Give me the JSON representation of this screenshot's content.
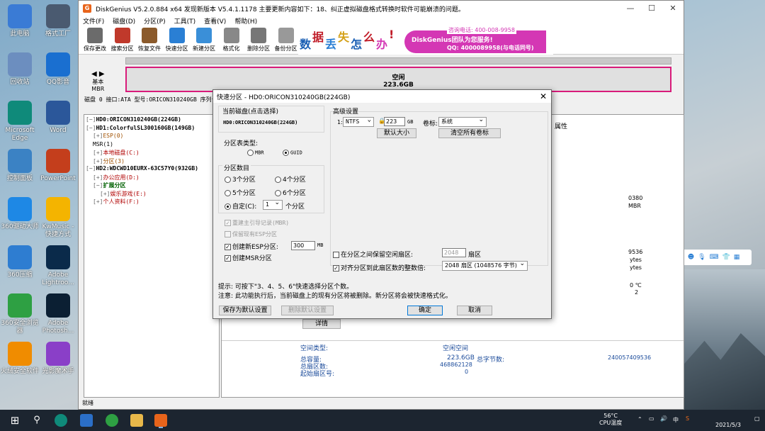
{
  "desktop": {
    "icons": [
      {
        "label": "此电脑",
        "color": "#3a7bd5"
      },
      {
        "label": "格式工厂",
        "color": "#4a5a70"
      },
      {
        "label": "回收站",
        "color": "#6c8ebf"
      },
      {
        "label": "QQ影音",
        "color": "#1a6fd0"
      },
      {
        "label": "Microsoft Edge",
        "color": "#0f8a7a"
      },
      {
        "label": "Word",
        "color": "#2b579a"
      },
      {
        "label": "控制面板",
        "color": "#3b82c4"
      },
      {
        "label": "PowerPoint",
        "color": "#c43e1c"
      },
      {
        "label": "360驱动大师",
        "color": "#1e88e5"
      },
      {
        "label": "KwMusic - 快捷方式",
        "color": "#f4b400"
      },
      {
        "label": "360压缩",
        "color": "#2e7dd1"
      },
      {
        "label": "Adobe Lightroo...",
        "color": "#0a2a4a"
      },
      {
        "label": "360安全浏览器",
        "color": "#2ea043"
      },
      {
        "label": "Adobe Photosh...",
        "color": "#0b1f33"
      },
      {
        "label": "火绒安全软件",
        "color": "#f08c00"
      },
      {
        "label": "光影魔术手",
        "color": "#8a3fc8"
      }
    ]
  },
  "app": {
    "title": "DiskGenius V5.2.0.884 x64   发现新版本 V5.4.1.1178 主要更新内容如下：18、纠正虚拟磁盘格式转换时软件可能崩溃的问题。",
    "menu": [
      "文件(F)",
      "磁盘(D)",
      "分区(P)",
      "工具(T)",
      "查看(V)",
      "帮助(H)"
    ],
    "toolbar": [
      {
        "label": "保存更改",
        "color": "#6b6b6b"
      },
      {
        "label": "搜索分区",
        "color": "#c0392b"
      },
      {
        "label": "恢复文件",
        "color": "#8b5a2b"
      },
      {
        "label": "快速分区",
        "color": "#2a7fd4"
      },
      {
        "label": "新建分区",
        "color": "#3a8fd8"
      },
      {
        "label": "格式化",
        "color": "#888888"
      },
      {
        "label": "删除分区",
        "color": "#777777"
      },
      {
        "label": "备份分区",
        "color": "#999999"
      }
    ],
    "banner": {
      "chars": [
        "数",
        "据",
        "丢",
        "失",
        "怎",
        "么",
        "办",
        "!"
      ],
      "phone": "咨询电话: 400-008-9958",
      "team": "DiskGenius团队为您服务!",
      "qq": "QQ: 4000089958(与电话同号)"
    },
    "diskmap": {
      "basic": "基本",
      "mbr": "MBR",
      "free_label": "空闲",
      "free_size": "223.6GB"
    },
    "disk_info": "磁盘 0 接口:ATA  型号:ORICON310240GB  序列号",
    "tree": [
      {
        "text": "HD0:ORICON310240GB(224GB)",
        "cls": "bold",
        "indent": 0,
        "exp": "−"
      },
      {
        "text": "HD1:ColorfulSL300160GB(149GB)",
        "cls": "bold",
        "indent": 0,
        "exp": "−"
      },
      {
        "text": "ESP(0)",
        "cls": "org",
        "indent": 2,
        "exp": "+"
      },
      {
        "text": "MSR(1)",
        "cls": "",
        "indent": 2,
        "exp": ""
      },
      {
        "text": "本地磁盘(C:)",
        "cls": "red",
        "indent": 2,
        "exp": "+"
      },
      {
        "text": "分区(3)",
        "cls": "org",
        "indent": 2,
        "exp": "+"
      },
      {
        "text": "HD2:WDCWD10EURX-63C57Y0(932GB)",
        "cls": "bold",
        "indent": 0,
        "exp": "−"
      },
      {
        "text": "办公应用(D:)",
        "cls": "red",
        "indent": 2,
        "exp": "+"
      },
      {
        "text": "扩展分区",
        "cls": "grn",
        "indent": 2,
        "exp": "−"
      },
      {
        "text": "娱乐游戏(E:)",
        "cls": "red",
        "indent": 4,
        "exp": "+"
      },
      {
        "text": "个人资料(F:)",
        "cls": "red",
        "indent": 2,
        "exp": "+"
      }
    ],
    "right_pane": {
      "attr_header": "属性",
      "r1": "0380",
      "r2": "MBR",
      "r3": "9536",
      "r4": "ytes",
      "r5": "ytes",
      "temp": "0 ℃",
      "two": "2",
      "detail_button": "详情",
      "space_type_label": "空间类型:",
      "space_type_value": "空闲空间",
      "total_label": "总容量:",
      "total_value": "223.6GB",
      "total_bytes_label": "总字节数:",
      "total_bytes_value": "240057409536",
      "sectors_label": "总扇区数:",
      "sectors_value": "468862128",
      "start_label": "起始扇区号:",
      "start_value": "0"
    },
    "status": "就绪"
  },
  "dialog": {
    "title": "快速分区 - HD0:ORICON310240GB(224GB)",
    "current_disk_label": "当前磁盘(点击选择)",
    "current_disk_value": "HD0:ORICON310240GB(224GB)",
    "table_type_label": "分区表类型:",
    "mbr": "MBR",
    "guid": "GUID",
    "count_label": "分区数目",
    "opt3": "3个分区",
    "opt4": "4个分区",
    "opt5": "5个分区",
    "opt6": "6个分区",
    "custom": "自定(C):",
    "custom_value": "1",
    "custom_unit": "个分区",
    "rebuild_mbr": "重建主引导记录(MBR)",
    "keep_esp": "保留现有ESP分区",
    "create_esp": "创建新ESP分区:",
    "esp_size": "300",
    "esp_unit": "MB",
    "create_msr": "创建MSR分区",
    "advanced_label": "高级设置",
    "row_index": "1:",
    "fs": "NTFS",
    "size": "223",
    "size_unit": "GB",
    "volume_label": "卷标:",
    "volume_value": "系统",
    "default_size_btn": "默认大小",
    "clear_labels_btn": "清空所有卷标",
    "keep_free_label": "在分区之间保留空闲扇区:",
    "keep_free_value": "2048",
    "keep_free_unit": "扇区",
    "align_label": "对齐分区到此扇区数的整数倍:",
    "align_value": "2048 扇区 (1048576 字节)",
    "tip1": "提示: 可按下\"3、4、5、6\"快速选择分区个数。",
    "tip2": "注意: 此功能执行后，当前磁盘上的现有分区将被删除。新分区将会被快速格式化。",
    "save_default": "保存为默认设置",
    "delete_default": "删除默认设置",
    "ok": "确定",
    "cancel": "取消"
  },
  "ime": {
    "lang": "中"
  },
  "taskbar": {
    "temp": "56°C",
    "temp_label": "CPU温度",
    "ime": "中",
    "date": "2021/5/3"
  }
}
